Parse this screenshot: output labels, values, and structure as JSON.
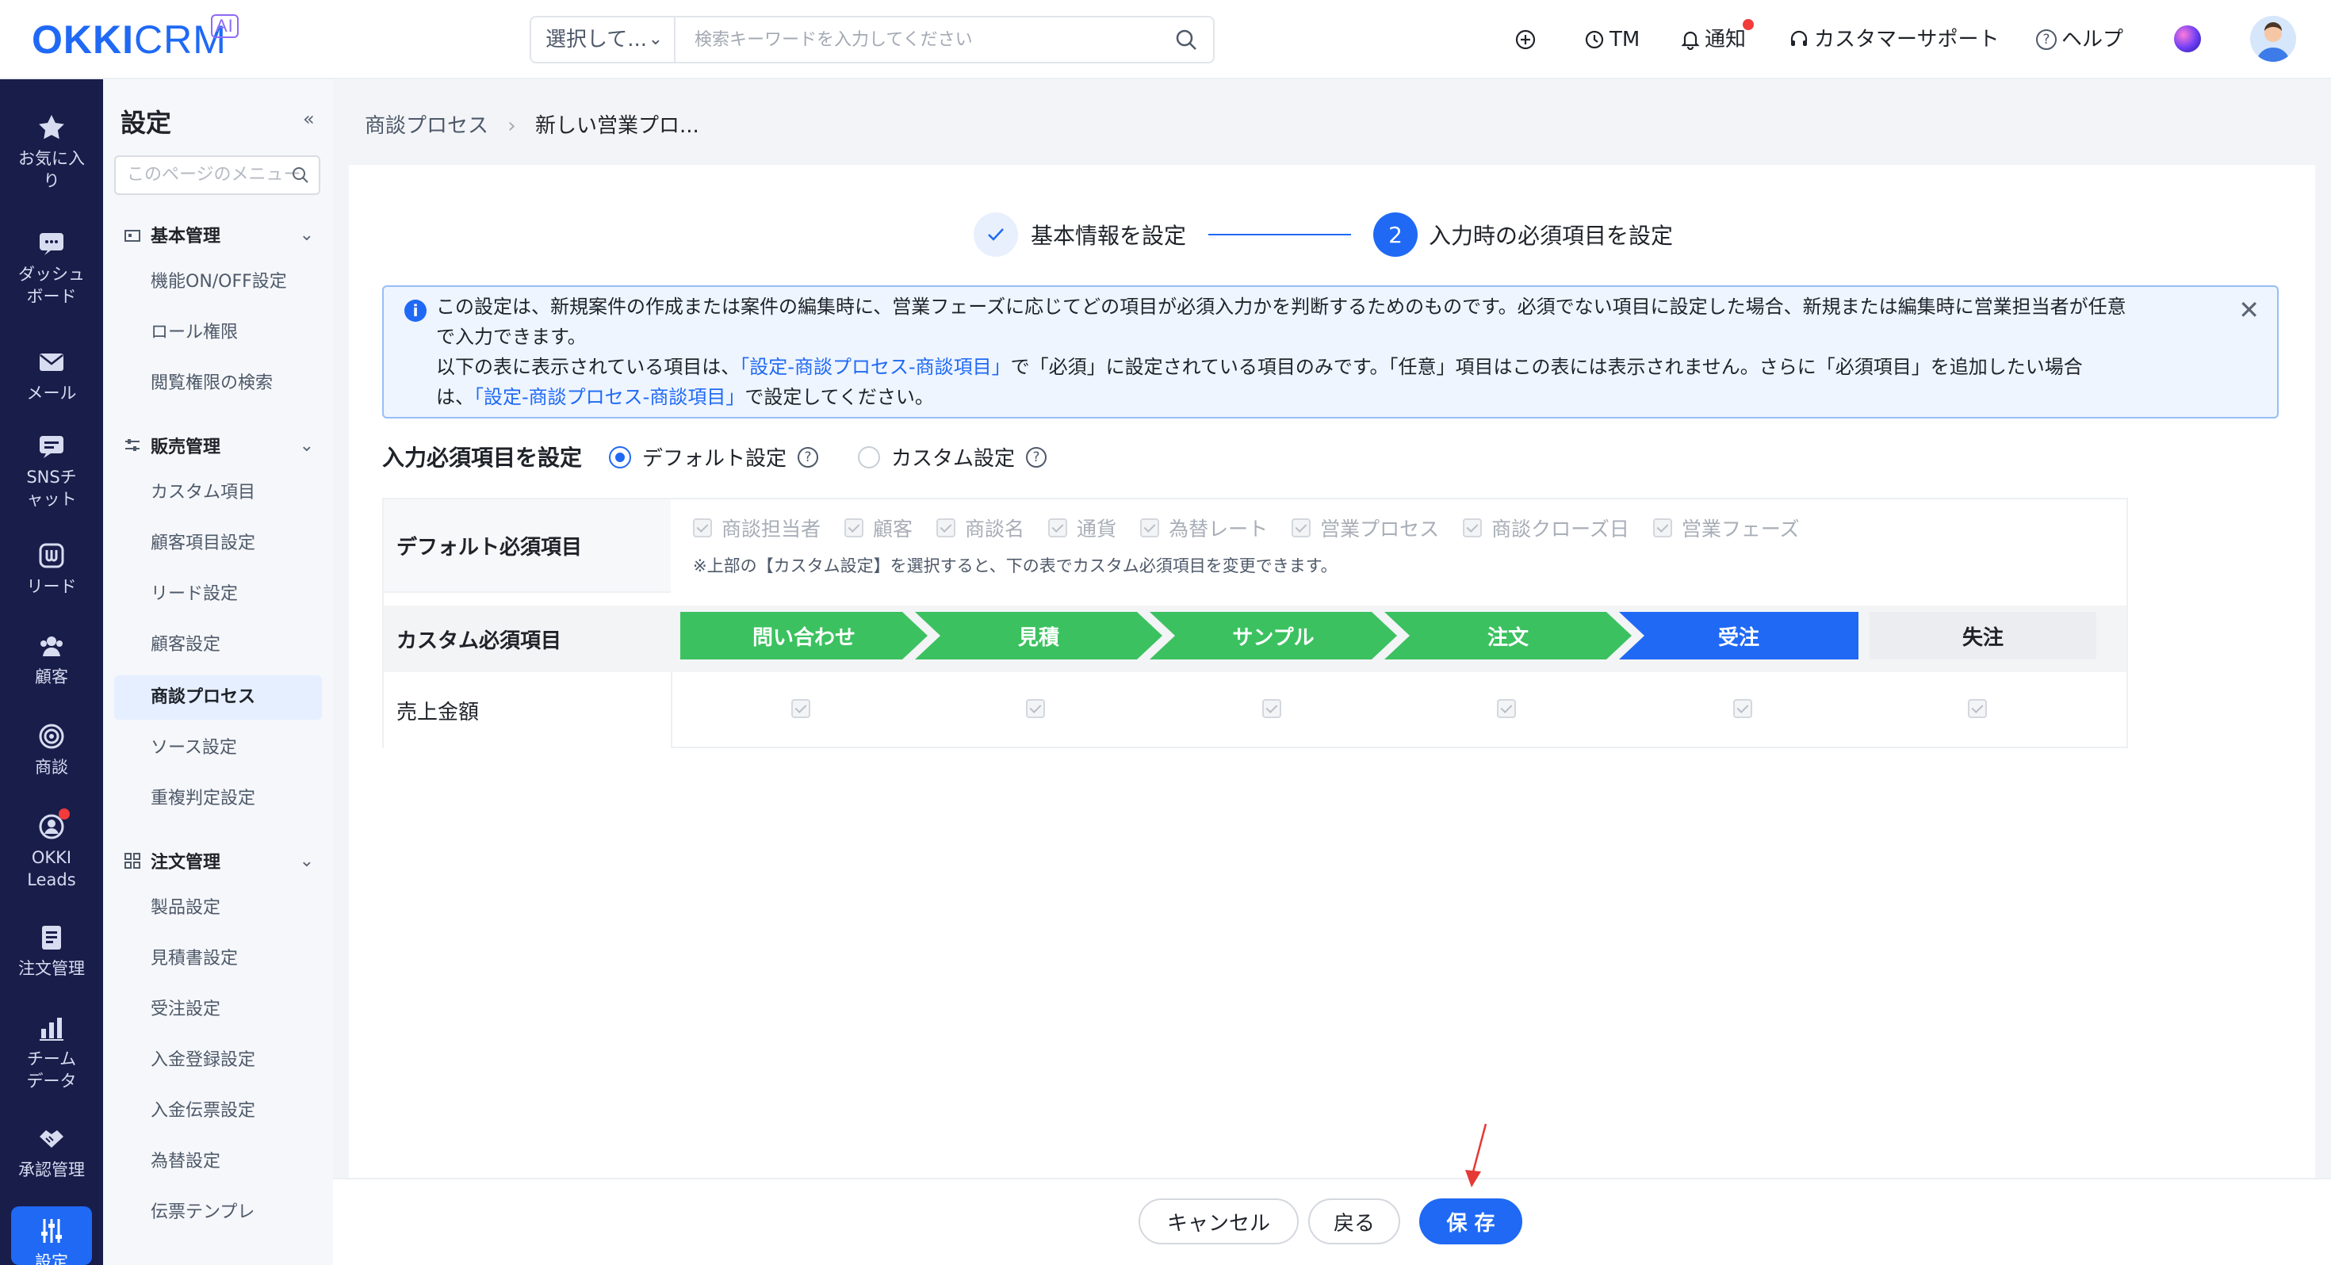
{
  "header": {
    "logo_main": "OKKI",
    "logo_sub": "CRM",
    "logo_badge": "AI",
    "search_select": "選択して...",
    "search_placeholder": "検索キーワードを入力してください",
    "nav": {
      "tm": "TM",
      "notice": "通知",
      "support": "カスタマーサポート",
      "help": "ヘルプ"
    }
  },
  "rail": [
    {
      "label": "お気に入り",
      "icon": "star-icon"
    },
    {
      "label": "ダッシュボード",
      "icon": "dashboard-icon"
    },
    {
      "label": "メール",
      "icon": "mail-icon"
    },
    {
      "label": "SNSチャット",
      "icon": "chat-icon"
    },
    {
      "label": "リード",
      "icon": "lead-icon"
    },
    {
      "label": "顧客",
      "icon": "customer-icon"
    },
    {
      "label": "商談",
      "icon": "target-icon"
    },
    {
      "label": "OKKI Leads",
      "icon": "leads-icon"
    },
    {
      "label": "注文管理",
      "icon": "order-icon"
    },
    {
      "label": "チームデータ",
      "icon": "chart-icon"
    },
    {
      "label": "承認管理",
      "icon": "handshake-icon"
    },
    {
      "label": "設定",
      "icon": "settings-icon"
    }
  ],
  "menu": {
    "title": "設定",
    "search_placeholder": "このページのメニュー",
    "sections": [
      {
        "title": "基本管理",
        "items": [
          "機能ON/OFF設定",
          "ロール権限",
          "閲覧権限の検索"
        ]
      },
      {
        "title": "販売管理",
        "items": [
          "カスタム項目",
          "顧客項目設定",
          "リード設定",
          "顧客設定",
          "商談プロセス",
          "ソース設定",
          "重複判定設定"
        ]
      },
      {
        "title": "注文管理",
        "items": [
          "製品設定",
          "見積書設定",
          "受注設定",
          "入金登録設定",
          "入金伝票設定",
          "為替設定",
          "伝票テンプレ"
        ]
      }
    ],
    "active": "商談プロセス"
  },
  "breadcrumb": {
    "parent": "商談プロセス",
    "current": "新しい営業プロ..."
  },
  "steps": [
    {
      "label": "基本情報を設定",
      "state": "done"
    },
    {
      "number": "2",
      "label": "入力時の必須項目を設定",
      "state": "active"
    }
  ],
  "notice": {
    "line1": "この設定は、新規案件の作成または案件の編集時に、営業フェーズに応じてどの項目が必須入力かを判断するためのものです。必須でない項目に設定した場合、新規または編集時に営業担当者が任意",
    "line2": "で入力できます。",
    "line3_a": "以下の表に表示されている項目は、",
    "line3_link": "「設定-商談プロセス-商談項目」",
    "line3_b": "で「必須」に設定されている項目のみです。「任意」項目はこの表には表示されません。さらに「必須項目」を追加したい場合",
    "line4_a": "は、",
    "line4_link": "「設定-商談プロセス-商談項目」",
    "line4_b": "で設定してください。"
  },
  "required": {
    "title": "入力必須項目を設定",
    "option_default": "デフォルト設定",
    "option_custom": "カスタム設定",
    "selected": "デフォルト設定",
    "default_label": "デフォルト必須項目",
    "default_fields": [
      "商談担当者",
      "顧客",
      "商談名",
      "通貨",
      "為替レート",
      "営業プロセス",
      "商談クローズ日",
      "営業フェーズ"
    ],
    "default_note": "※上部の【カスタム設定】を選択すると、下の表でカスタム必須項目を変更できます。",
    "custom_label": "カスタム必須項目",
    "phases": [
      {
        "label": "問い合わせ",
        "color": "#3cc160"
      },
      {
        "label": "見積",
        "color": "#3cc160"
      },
      {
        "label": "サンプル",
        "color": "#3cc160"
      },
      {
        "label": "注文",
        "color": "#3cc160"
      },
      {
        "label": "受注",
        "color": "#1f69f5"
      },
      {
        "label": "失注",
        "color": "#ebedf0"
      }
    ],
    "field_rows": [
      {
        "label": "売上金額",
        "checked": [
          true,
          true,
          true,
          true,
          true,
          true
        ]
      }
    ]
  },
  "footer": {
    "cancel": "キャンセル",
    "back": "戻る",
    "save": "保 存"
  }
}
